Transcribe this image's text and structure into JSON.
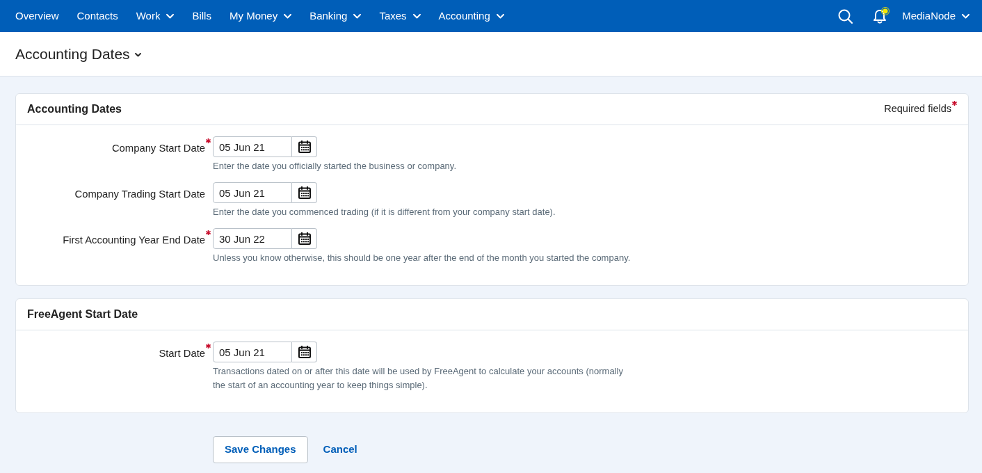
{
  "nav": {
    "items": [
      {
        "label": "Overview",
        "dropdown": false
      },
      {
        "label": "Contacts",
        "dropdown": false
      },
      {
        "label": "Work",
        "dropdown": true
      },
      {
        "label": "Bills",
        "dropdown": false
      },
      {
        "label": "My Money",
        "dropdown": true
      },
      {
        "label": "Banking",
        "dropdown": true
      },
      {
        "label": "Taxes",
        "dropdown": true
      },
      {
        "label": "Accounting",
        "dropdown": true
      }
    ],
    "account": {
      "label": "MediaNode",
      "dropdown": true
    }
  },
  "notifications": {
    "unread": true
  },
  "page_header": {
    "title": "Accounting Dates",
    "dropdown": true
  },
  "panels": [
    {
      "title": "Accounting Dates",
      "required_note": "Required fields",
      "fields": [
        {
          "label": "Company Start Date",
          "required": true,
          "value": "05 Jun 21",
          "hint": "Enter the date you officially started the business or company."
        },
        {
          "label": "Company Trading Start Date",
          "required": false,
          "value": "05 Jun 21",
          "hint": "Enter the date you commenced trading (if it is different from your company start date)."
        },
        {
          "label": "First Accounting Year End Date",
          "required": true,
          "value": "30 Jun 22",
          "hint": "Unless you know otherwise, this should be one year after the end of the month you started the company."
        }
      ]
    },
    {
      "title": "FreeAgent Start Date",
      "fields": [
        {
          "label": "Start Date",
          "required": true,
          "value": "05 Jun 21",
          "hint": "Transactions dated on or after this date will be used by FreeAgent to calculate your accounts (normally the start of an accounting year to keep things simple)."
        }
      ]
    }
  ],
  "actions": {
    "save": "Save Changes",
    "cancel": "Cancel"
  }
}
